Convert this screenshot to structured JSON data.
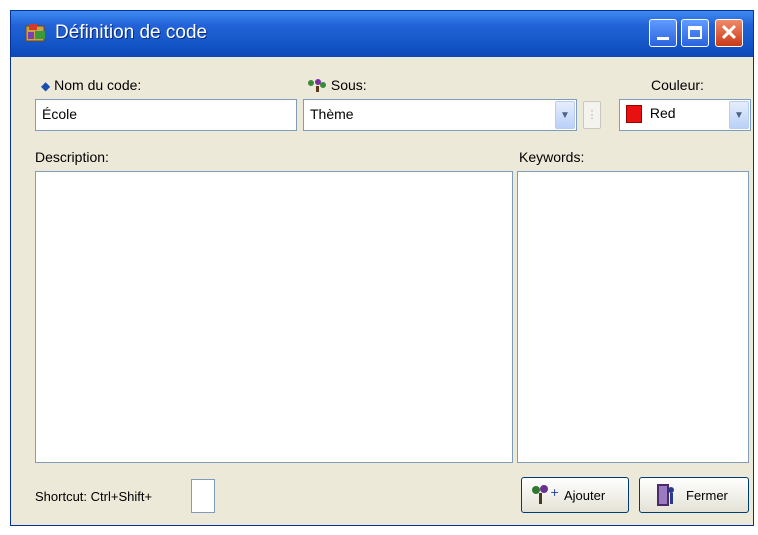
{
  "window": {
    "title": "Définition de code"
  },
  "form": {
    "code_name_label": "Nom du code:",
    "code_name_value": "École",
    "parent_label": "Sous:",
    "parent_value": "Thème",
    "color_label": "Couleur:",
    "color_value": "Red",
    "color_swatch": "#e81010",
    "description_label": "Description:",
    "keywords_label": "Keywords:",
    "shortcut_label": "Shortcut: Ctrl+Shift+"
  },
  "buttons": {
    "add_label": "Ajouter",
    "close_label": "Fermer"
  },
  "icons": {
    "title": "codebook-icon",
    "code_name": "diamond-icon",
    "parent": "tree-icon",
    "add": "add-code-icon",
    "close": "exit-door-icon"
  }
}
